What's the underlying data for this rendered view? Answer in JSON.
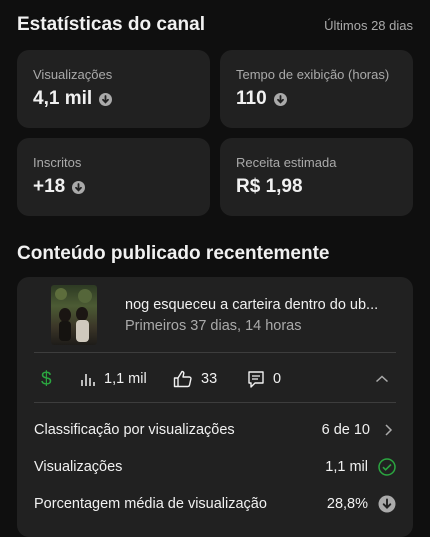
{
  "header": {
    "title": "Estatísticas do canal",
    "period": "Últimos 28 dias"
  },
  "stats": [
    {
      "label": "Visualizações",
      "value": "4,1 mil",
      "trend_icon": "arrow-down-circle-icon"
    },
    {
      "label": "Tempo de exibição (horas)",
      "value": "110",
      "trend_icon": "arrow-down-circle-icon"
    },
    {
      "label": "Inscritos",
      "value": "+18",
      "trend_icon": "arrow-down-circle-icon"
    },
    {
      "label": "Receita estimada",
      "value": "R$ 1,98"
    }
  ],
  "recent": {
    "title": "Conteúdo publicado recentemente",
    "video": {
      "title": "nog esqueceu a carteira dentro do ub...",
      "subtitle": "Primeiros 37 dias, 14 horas"
    },
    "metrics": {
      "views": "1,1 mil",
      "likes": "33",
      "comments": "0"
    },
    "details": [
      {
        "label": "Classificação por visualizações",
        "value": "6 de 10",
        "icon": "chevron-right-icon"
      },
      {
        "label": "Visualizações",
        "value": "1,1 mil",
        "icon": "check-circle-icon"
      },
      {
        "label": "Porcentagem média de visualização",
        "value": "28,8%",
        "icon": "arrow-down-circle-icon"
      }
    ]
  },
  "colors": {
    "background": "#0f0f0f",
    "card": "#212121",
    "money_green": "#2ba640",
    "check_green": "#2ba640",
    "muted": "#aaaaaa"
  }
}
